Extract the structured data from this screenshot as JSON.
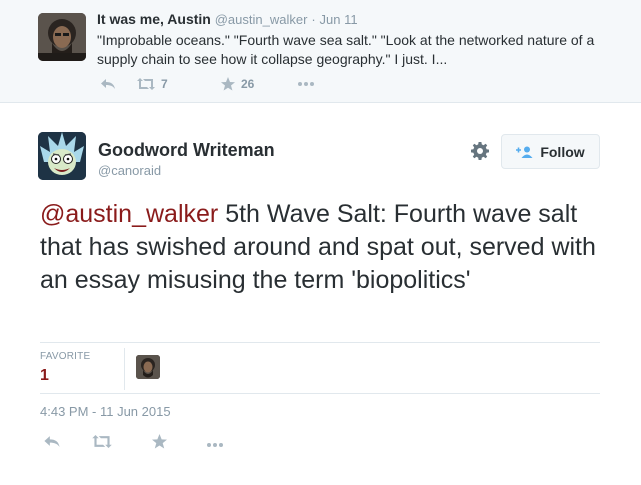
{
  "parent_tweet": {
    "name": "It was me, Austin",
    "handle": "@austin_walker",
    "separator": "·",
    "date": "Jun 11",
    "text": "\"Improbable oceans.\" \"Fourth wave sea salt.\" \"Look at the networked nature of a supply chain to see how it collapse geography.\" I just. I...",
    "retweets": "7",
    "favorites": "26"
  },
  "main_tweet": {
    "name": "Goodword Writeman",
    "handle": "@canoraid",
    "follow_label": "Follow",
    "mention": "@austin_walker",
    "text": " 5th Wave Salt: Fourth wave salt that has swished around and spat out, served with an essay misusing the term 'biopolitics'",
    "stats": {
      "label": "FAVORITE",
      "value": "1"
    },
    "timestamp": "4:43 PM - 11 Jun 2015"
  },
  "icons": {
    "reply": "reply-icon",
    "retweet": "retweet-icon",
    "favorite": "star-icon",
    "more": "more-icon",
    "settings": "gear-icon",
    "follow": "follow-person-icon"
  },
  "colors": {
    "mention": "#8a1b1b",
    "favorite_count": "#8a1b1b",
    "muted": "#8899a6",
    "action_icon": "#aab8c2",
    "parent_bg": "#f5f8fa",
    "follow_accent": "#55acee"
  }
}
